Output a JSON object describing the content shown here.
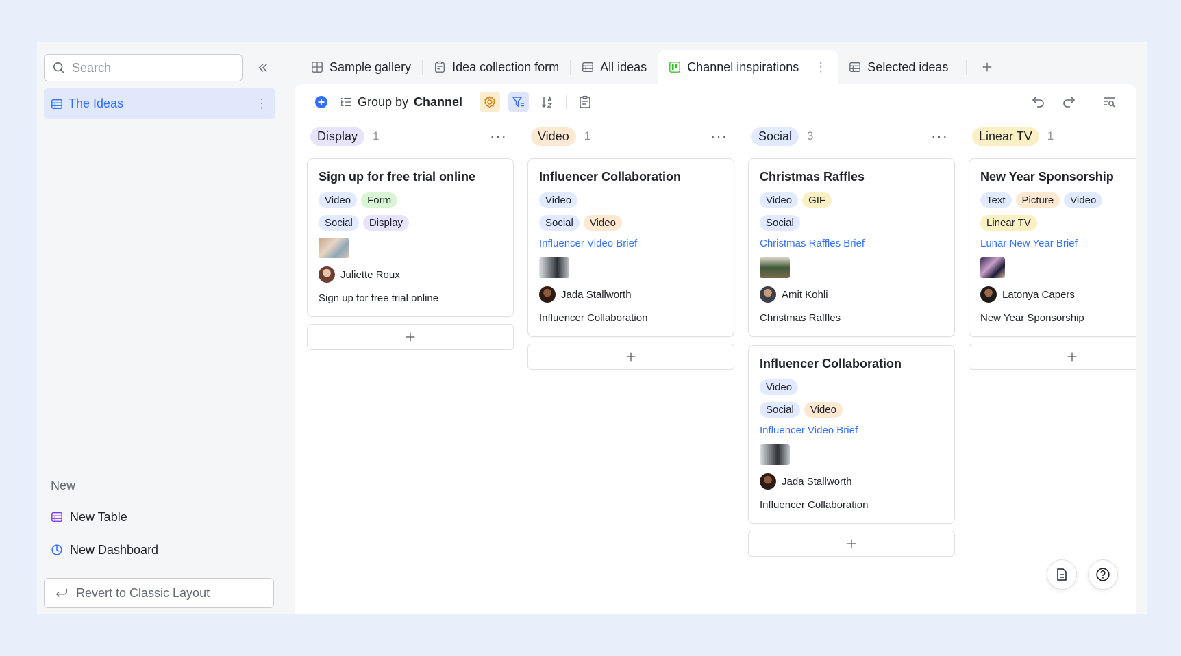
{
  "sidebar": {
    "search_placeholder": "Search",
    "nav": {
      "label": "The Ideas"
    },
    "new_section": {
      "title": "New",
      "items": [
        {
          "label": "New Table"
        },
        {
          "label": "New Dashboard"
        }
      ]
    },
    "revert_label": "Revert to Classic Layout"
  },
  "tabs": [
    {
      "label": "Sample gallery"
    },
    {
      "label": "Idea collection form"
    },
    {
      "label": "All ideas"
    },
    {
      "label": "Channel inspirations"
    },
    {
      "label": "Selected ideas"
    }
  ],
  "toolbar": {
    "group_prefix": "Group by",
    "group_field": "Channel"
  },
  "columns": [
    {
      "name": "Display",
      "count": "1",
      "cards": [
        {
          "title": "Sign up for free trial online",
          "tags_row1": [
            "Video",
            "Form"
          ],
          "tags_row2": [
            "Social",
            "Display"
          ],
          "link": "",
          "person": "Juliette Roux",
          "desc": "Sign up for free trial online"
        }
      ]
    },
    {
      "name": "Video",
      "count": "1",
      "cards": [
        {
          "title": "Influencer Collaboration",
          "tags_row1": [
            "Video"
          ],
          "tags_row2": [
            "Social",
            "Video"
          ],
          "link": "Influencer Video Brief",
          "person": "Jada Stallworth",
          "desc": "Influencer Collaboration"
        }
      ]
    },
    {
      "name": "Social",
      "count": "3",
      "cards": [
        {
          "title": "Christmas Raffles",
          "tags_row1": [
            "Video",
            "GIF"
          ],
          "tags_row2": [
            "Social"
          ],
          "link": "Christmas Raffles Brief",
          "person": "Amit Kohli",
          "desc": "Christmas Raffles"
        },
        {
          "title": "Influencer Collaboration",
          "tags_row1": [
            "Video"
          ],
          "tags_row2": [
            "Social",
            "Video"
          ],
          "link": "Influencer Video Brief",
          "person": "Jada Stallworth",
          "desc": "Influencer Collaboration"
        }
      ]
    },
    {
      "name": "Linear TV",
      "count": "1",
      "cards": [
        {
          "title": "New Year Sponsorship",
          "tags_row1": [
            "Text",
            "Picture",
            "Video"
          ],
          "tags_row2": [
            "Linear TV"
          ],
          "link": "Lunar New Year Brief",
          "person": "Latonya Capers",
          "desc": "New Year Sponsorship"
        }
      ]
    }
  ],
  "colors": {
    "accent": "#3370ff",
    "active_nav_bg": "#e1e8fb",
    "board_bg": "#ffffff",
    "page_bg": "#e9eefb"
  }
}
